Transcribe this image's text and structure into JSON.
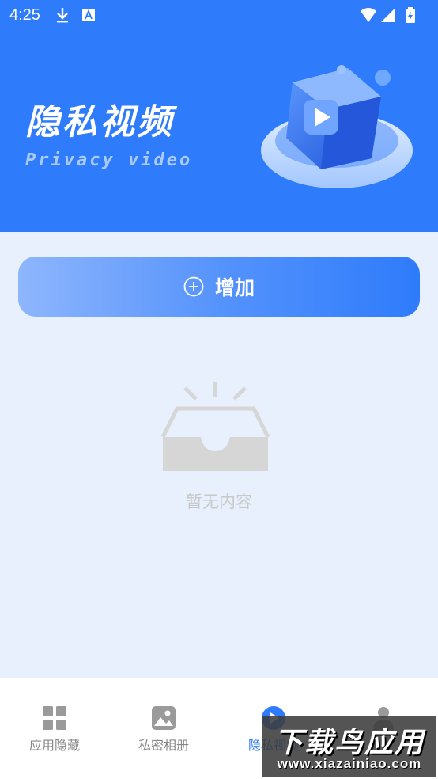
{
  "status_bar": {
    "time": "4:25",
    "icons": [
      "download-icon",
      "a-notification-icon",
      "wifi-icon",
      "signal-icon",
      "battery-icon"
    ]
  },
  "header": {
    "title": "隐私视频",
    "subtitle": "Privacy video",
    "background_color": "#2E7BFB",
    "illustration": "video-cube-illustration"
  },
  "add_button": {
    "label": "增加",
    "icon": "plus-circle-icon"
  },
  "empty_state": {
    "icon": "empty-tray-icon",
    "text": "暂无内容"
  },
  "bottom_nav": {
    "items": [
      {
        "label": "应用隐藏",
        "icon": "grid-icon",
        "active": false
      },
      {
        "label": "私密相册",
        "icon": "image-icon",
        "active": false
      },
      {
        "label": "隐私视频",
        "icon": "play-icon",
        "active": true
      },
      {
        "label": "",
        "icon": "person-icon",
        "active": false
      }
    ],
    "active_color": "#2E7BFB",
    "inactive_color": "#888888"
  },
  "watermark": {
    "title": "下载鸟应用",
    "url": "www.xiazainiao.com"
  }
}
